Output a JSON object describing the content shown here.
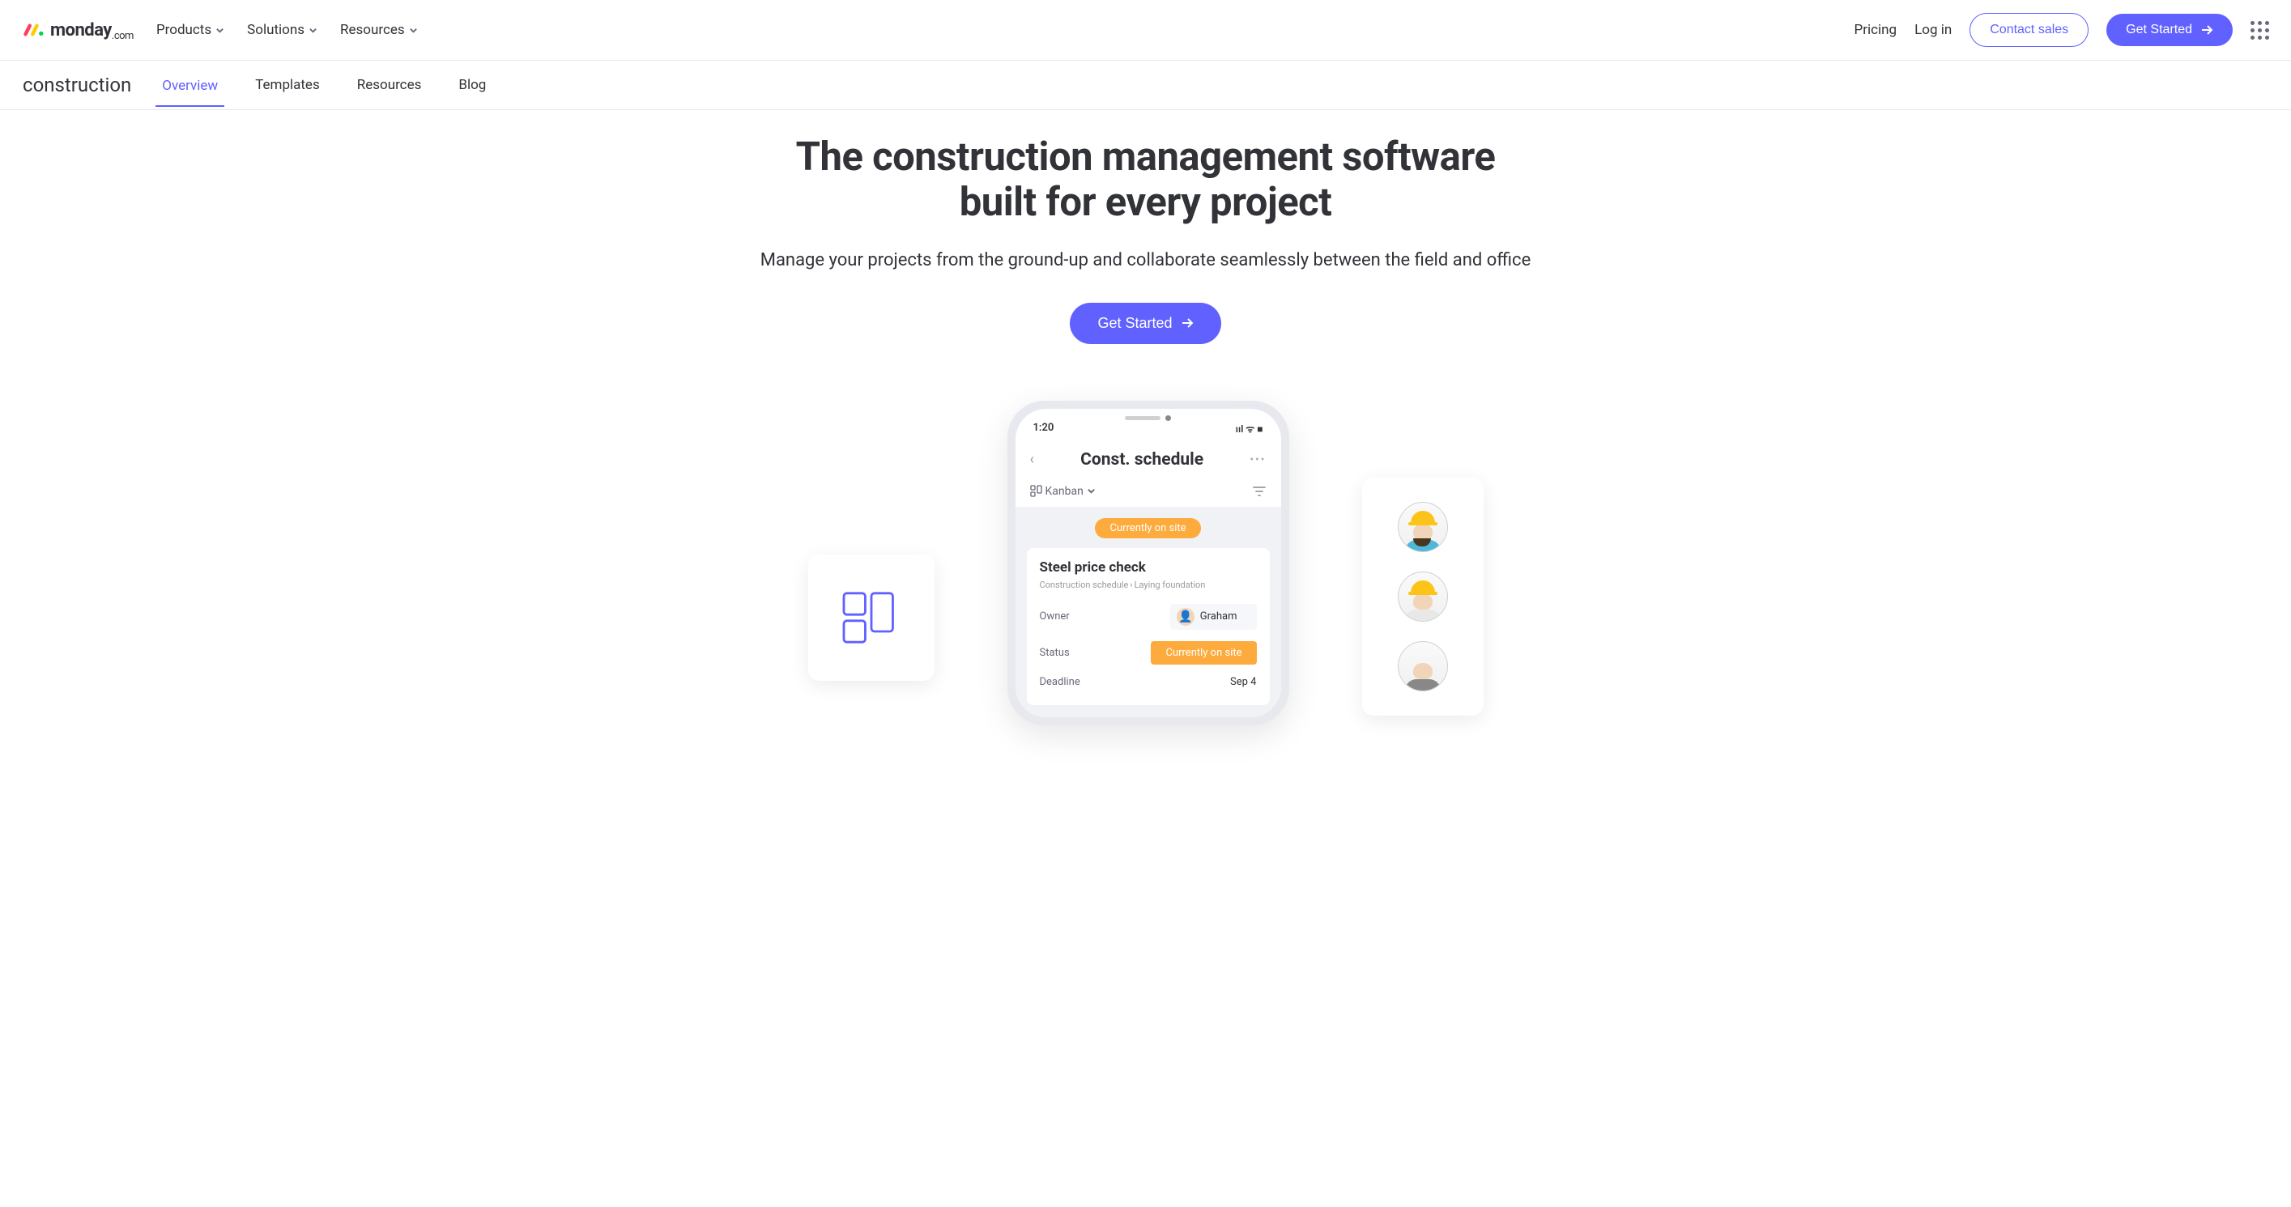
{
  "topNav": {
    "logoText": "monday",
    "logoSuffix": ".com",
    "items": [
      "Products",
      "Solutions",
      "Resources"
    ],
    "pricing": "Pricing",
    "login": "Log in",
    "contactSales": "Contact sales",
    "getStarted": "Get Started"
  },
  "subNav": {
    "title": "construction",
    "items": [
      "Overview",
      "Templates",
      "Resources",
      "Blog"
    ],
    "activeIndex": 0
  },
  "hero": {
    "title_line1": "The construction management software",
    "title_line2": "built for every project",
    "subtitle": "Manage your projects from the ground-up and collaborate seamlessly between the field and office",
    "cta": "Get Started"
  },
  "phone": {
    "time": "1:20",
    "signalIcons": "ııl ᯤ ■",
    "appTitle": "Const. schedule",
    "viewName": "Kanban",
    "columnStatus": "Currently on site",
    "card": {
      "title": "Steel price check",
      "breadcrumb1": "Construction schedule",
      "breadcrumb2": "Laying foundation",
      "ownerLabel": "Owner",
      "ownerName": "Graham",
      "statusLabel": "Status",
      "statusValue": "Currently on site",
      "deadlineLabel": "Deadline",
      "deadlineValue": "Sep 4"
    }
  }
}
